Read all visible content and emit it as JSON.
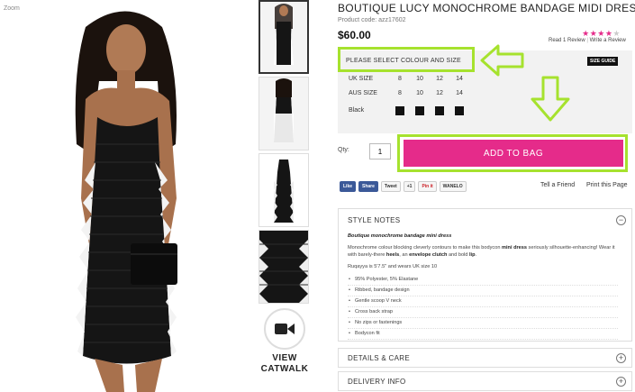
{
  "gallery": {
    "zoom_label": "Zoom",
    "catwalk_label_1": "VIEW",
    "catwalk_label_2": "CATWALK"
  },
  "product": {
    "title": "BOUTIQUE LUCY MONOCHROME BANDAGE MIDI DRESS",
    "code": "Product code: azz17602",
    "price": "$60.00",
    "rating": 4,
    "rating_max": 5,
    "read_review": "Read 1 Review",
    "write_review": "Write a Review"
  },
  "options": {
    "select_label": "PLEASE SELECT COLOUR AND SIZE",
    "size_guide": "SIZE GUIDE",
    "uk_label": "UK SIZE",
    "uk_sizes": [
      "8",
      "10",
      "12",
      "14"
    ],
    "aus_label": "AUS SIZE",
    "aus_sizes": [
      "8",
      "10",
      "12",
      "14"
    ],
    "colour_label": "Black"
  },
  "purchase": {
    "qty_label": "Qty:",
    "qty_value": "1",
    "add_to_bag": "ADD TO BAG"
  },
  "social": {
    "like": "Like",
    "share": "Share",
    "tweet": "Tweet",
    "gplus": "+1",
    "pin": "Pin it",
    "wanelo": "WANELO",
    "tell_friend": "Tell a Friend",
    "print": "Print this Page"
  },
  "style_notes": {
    "heading": "STYLE NOTES",
    "toggle": "−",
    "intro": "Boutique monochrome bandage mini dress",
    "para_1a": "Monochrome colour blocking cleverly contours to make this bodycon ",
    "para_1b": "mini dress",
    "para_1c": " seriously silhouette-enhancing! Wear it with barely-there ",
    "para_1d": "heels",
    "para_1e": ", an ",
    "para_1f": "envelope clutch",
    "para_1g": " and bold ",
    "para_1h": "lip",
    "para_1i": ".",
    "model": "Ruqayya is 5'7.5\" and wears UK size 10",
    "bullets": [
      "95% Polyester, 5% Elastane",
      "Ribbed, bandage design",
      "Gentle scoop V neck",
      "Cross back strap",
      "No zips or fastenings",
      "Bodycon fit"
    ]
  },
  "details": {
    "heading": "DETAILS & CARE",
    "toggle": "+"
  },
  "delivery": {
    "heading": "DELIVERY INFO",
    "toggle": "+"
  },
  "colors": {
    "accent_pink": "#e52b8a",
    "highlight_green": "#a6e22e",
    "options_bg": "#f2f2f2"
  }
}
